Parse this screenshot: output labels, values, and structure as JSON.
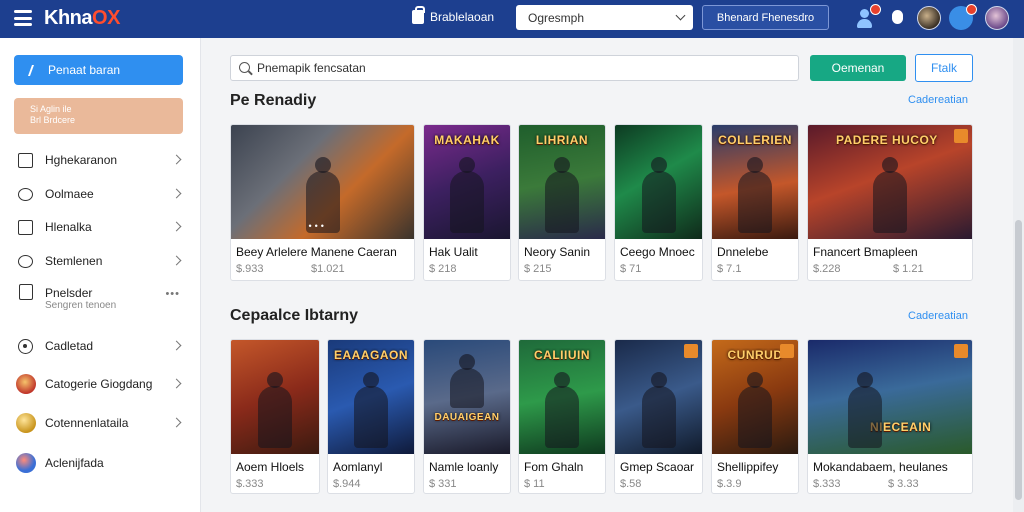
{
  "topbar": {
    "logo_main": "Khna",
    "logo_accent": "O",
    "logo_tail": "X",
    "store_label": "Brablelaoan",
    "select_value": "Ogresmph",
    "button_label": "Bhenard Fhenesdro"
  },
  "sidebar": {
    "primary_button": "Penaat baran",
    "promo_line1": "Si Aglin ile",
    "promo_line2": "Brl Brdcere",
    "items": [
      {
        "label": "Hghekaranon",
        "icon": "square-icon"
      },
      {
        "label": "Oolmaee",
        "icon": "chat-bubble-icon"
      },
      {
        "label": "Hlenalka",
        "icon": "square-icon"
      },
      {
        "label": "Stemlenen",
        "icon": "message-icon"
      },
      {
        "label": "Pnelsder",
        "sub": "Sengren tenoen",
        "icon": "document-icon"
      },
      {
        "label": "Cadletad",
        "icon": "target-icon"
      },
      {
        "label": "Catogerie Giogdang",
        "icon": "avatar-icon"
      },
      {
        "label": "Cotennenlataila",
        "icon": "coin-icon"
      },
      {
        "label": "Aclenijfada",
        "icon": "globe-icon"
      }
    ]
  },
  "main": {
    "search_value": "Pnemapik fencsatan",
    "green_button": "Oemenan",
    "outline_button": "Ftalk",
    "section1": {
      "title": "Pe Renadiy",
      "link": "Cadereatian",
      "cards": [
        {
          "title": "Beey Arlelere Manene Caeran",
          "price": "$.933",
          "price2": "$1.021",
          "art_text": ""
        },
        {
          "title": "Hak Ualit",
          "price": "$ 218",
          "art_text": "MAKAHAK"
        },
        {
          "title": "Neory Sanin",
          "price": "$ 215",
          "art_text": "LIHRIAN"
        },
        {
          "title": "Ceego Mnoec",
          "price": "$ 71",
          "art_text": ""
        },
        {
          "title": "Dnnelebe",
          "price": "$ 7.1",
          "art_text": "COLLERIEN"
        },
        {
          "title": "Fnancert Bmapleen",
          "price": "$.228",
          "price2": "$ 1.21",
          "art_text": "PADERE HUCOY"
        }
      ]
    },
    "section2": {
      "title": "Cepaalce Ibtarny",
      "link": "Cadereatian",
      "cards": [
        {
          "title": "Aoem Hloels",
          "price": "$.333",
          "art_text": ""
        },
        {
          "title": "Aomlanyl",
          "price": "$.944",
          "art_text": "EAAAGAON"
        },
        {
          "title": "Namle loanly",
          "price": "$ 331",
          "art_text": "DAUAIGEAN"
        },
        {
          "title": "Fom Ghaln",
          "price": "$ 11",
          "art_text": "CALIIUIN"
        },
        {
          "title": "Gmep Scaoar",
          "price": "$.58",
          "art_text": ""
        },
        {
          "title": "Shellippifey",
          "price": "$.3.9",
          "art_text": "CUNRUD"
        },
        {
          "title": "Mokandabaem, heulanes",
          "price": "$.333",
          "price2": "$ 3.33",
          "art_text": "NIECEAIN"
        }
      ]
    }
  },
  "colors": {
    "topbar": "#1d3f8f",
    "primary": "#2f8ff0",
    "green": "#17a884",
    "promo": "#eab99a"
  }
}
